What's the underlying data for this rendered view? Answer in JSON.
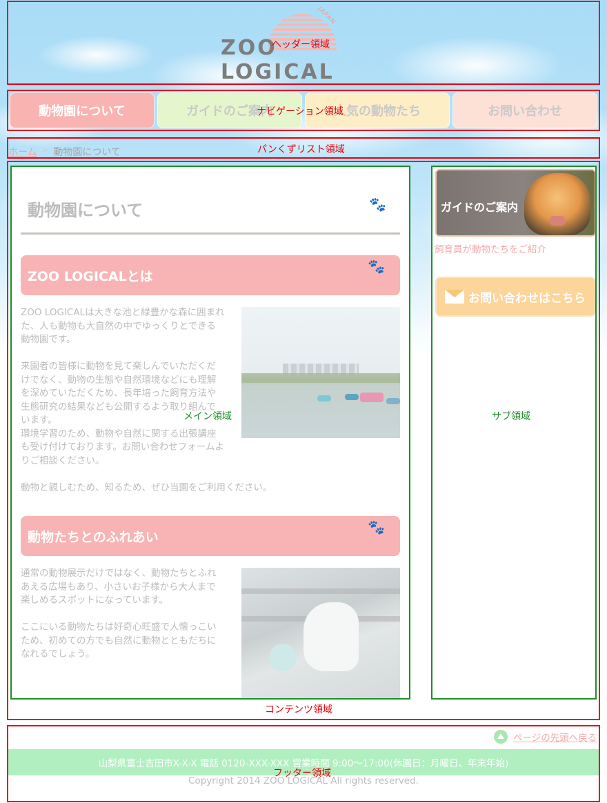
{
  "header": {
    "logo_text": "ZOO LOGICAL",
    "logo_sub": "JAPAN",
    "region_label": "ヘッダー領域"
  },
  "nav": {
    "region_label": "ナビゲーション領域",
    "items": [
      {
        "label": "動物園について"
      },
      {
        "label": "ガイドのご案内"
      },
      {
        "label": "人気の動物たち"
      },
      {
        "label": "お問い合わせ"
      }
    ]
  },
  "breadcrumb": {
    "region_label": "パンくずリスト領域",
    "home": "ホーム",
    "separator": ">",
    "current": "動物園について"
  },
  "contents": {
    "region_label": "コンテンツ領域",
    "main_label": "メイン領域",
    "sub_label": "サブ領域"
  },
  "main": {
    "page_title": "動物園について",
    "sections": [
      {
        "heading": "ZOO LOGICALとは",
        "text": "ZOO LOGICALは大きな池と緑豊かな森に囲まれた、人も動物も大自然の中でゆっくりとできる動物園です。\n\n来園者の皆様に動物を見て楽しんでいただくだけでなく、動物の生態や自然環境などにも理解を深めていただくため、長年培った飼育方法や生態研究の結果なども公開するよう取り組んでいます。\n環境学習のため、動物や自然に関する出張講座も受け付けております。お問い合わせフォームよりご相談ください。",
        "text_extra": "動物と親しむため、知るため、ぜひ当園をご利用ください。"
      },
      {
        "heading": "動物たちとのふれあい",
        "text": "通常の動物展示だけではなく、動物たちとふれあえる広場もあり、小さいお子様から大人まで楽しめるスポットになっています。\n\nここにいる動物たちは好奇心旺盛で人懐っこいため、初めての方でも自然に動物とともだちになれるでしょう。"
      }
    ]
  },
  "sub": {
    "guide_banner": "ガイドのご案内",
    "guide_caption": "飼育員が動物たちをご紹介",
    "contact_button": "お問い合わせはこちら"
  },
  "footer": {
    "region_label": "フッター領域",
    "pagetop": "ページの先頭へ戻る",
    "address": "山梨県富士吉田市X-X-X 電話 0120-XXX-XXX 営業時間 9:00～17:00(休園日：月曜日、年末年始)",
    "copyright": "Copyright 2014 ZOO LOGICAL All rights reserved."
  },
  "colors": {
    "region_outline": "#e8000b",
    "subregion_outline": "#1a8f28",
    "nav_active": "#f9b3b1",
    "section_heading": "#f8b4b4",
    "footer_bar": "#b1efc1"
  }
}
